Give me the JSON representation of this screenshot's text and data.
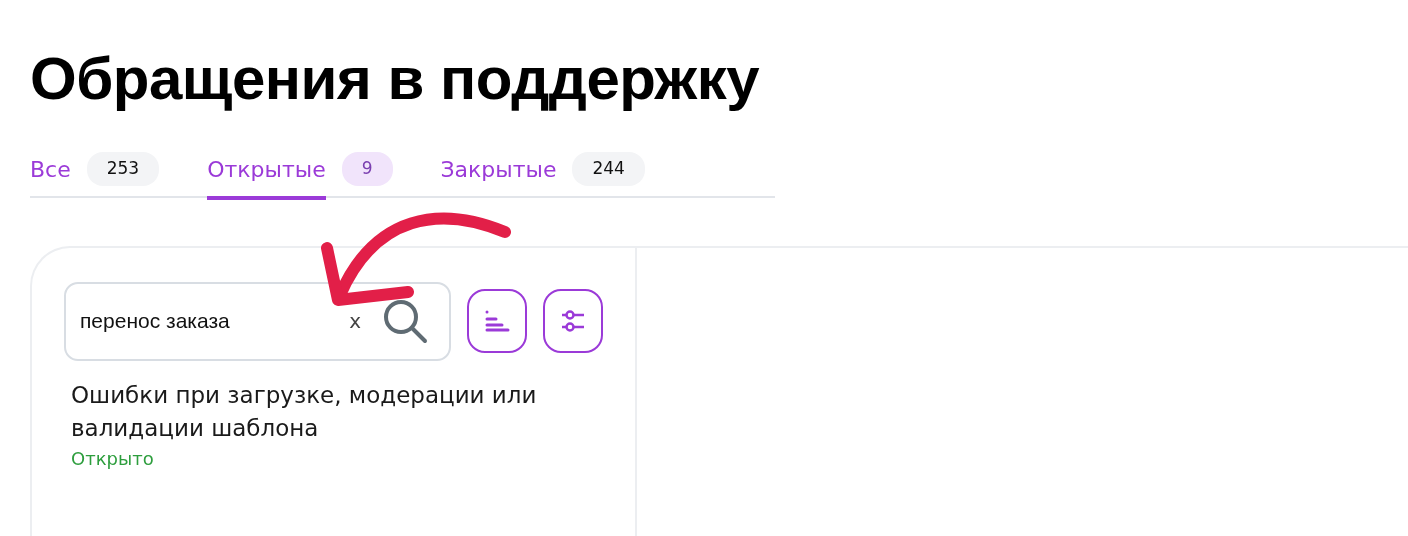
{
  "page": {
    "title": "Обращения в поддержку"
  },
  "tabs": [
    {
      "label": "Все",
      "count": "253",
      "selected": false
    },
    {
      "label": "Открытые",
      "count": "9",
      "selected": true
    },
    {
      "label": "Закрытые",
      "count": "244",
      "selected": false
    }
  ],
  "search": {
    "value": "перенос заказа",
    "clear": "x"
  },
  "tickets": [
    {
      "title": "Ошибки при загрузке, модерации или валидации шаблона",
      "status": "Открыто"
    }
  ]
}
